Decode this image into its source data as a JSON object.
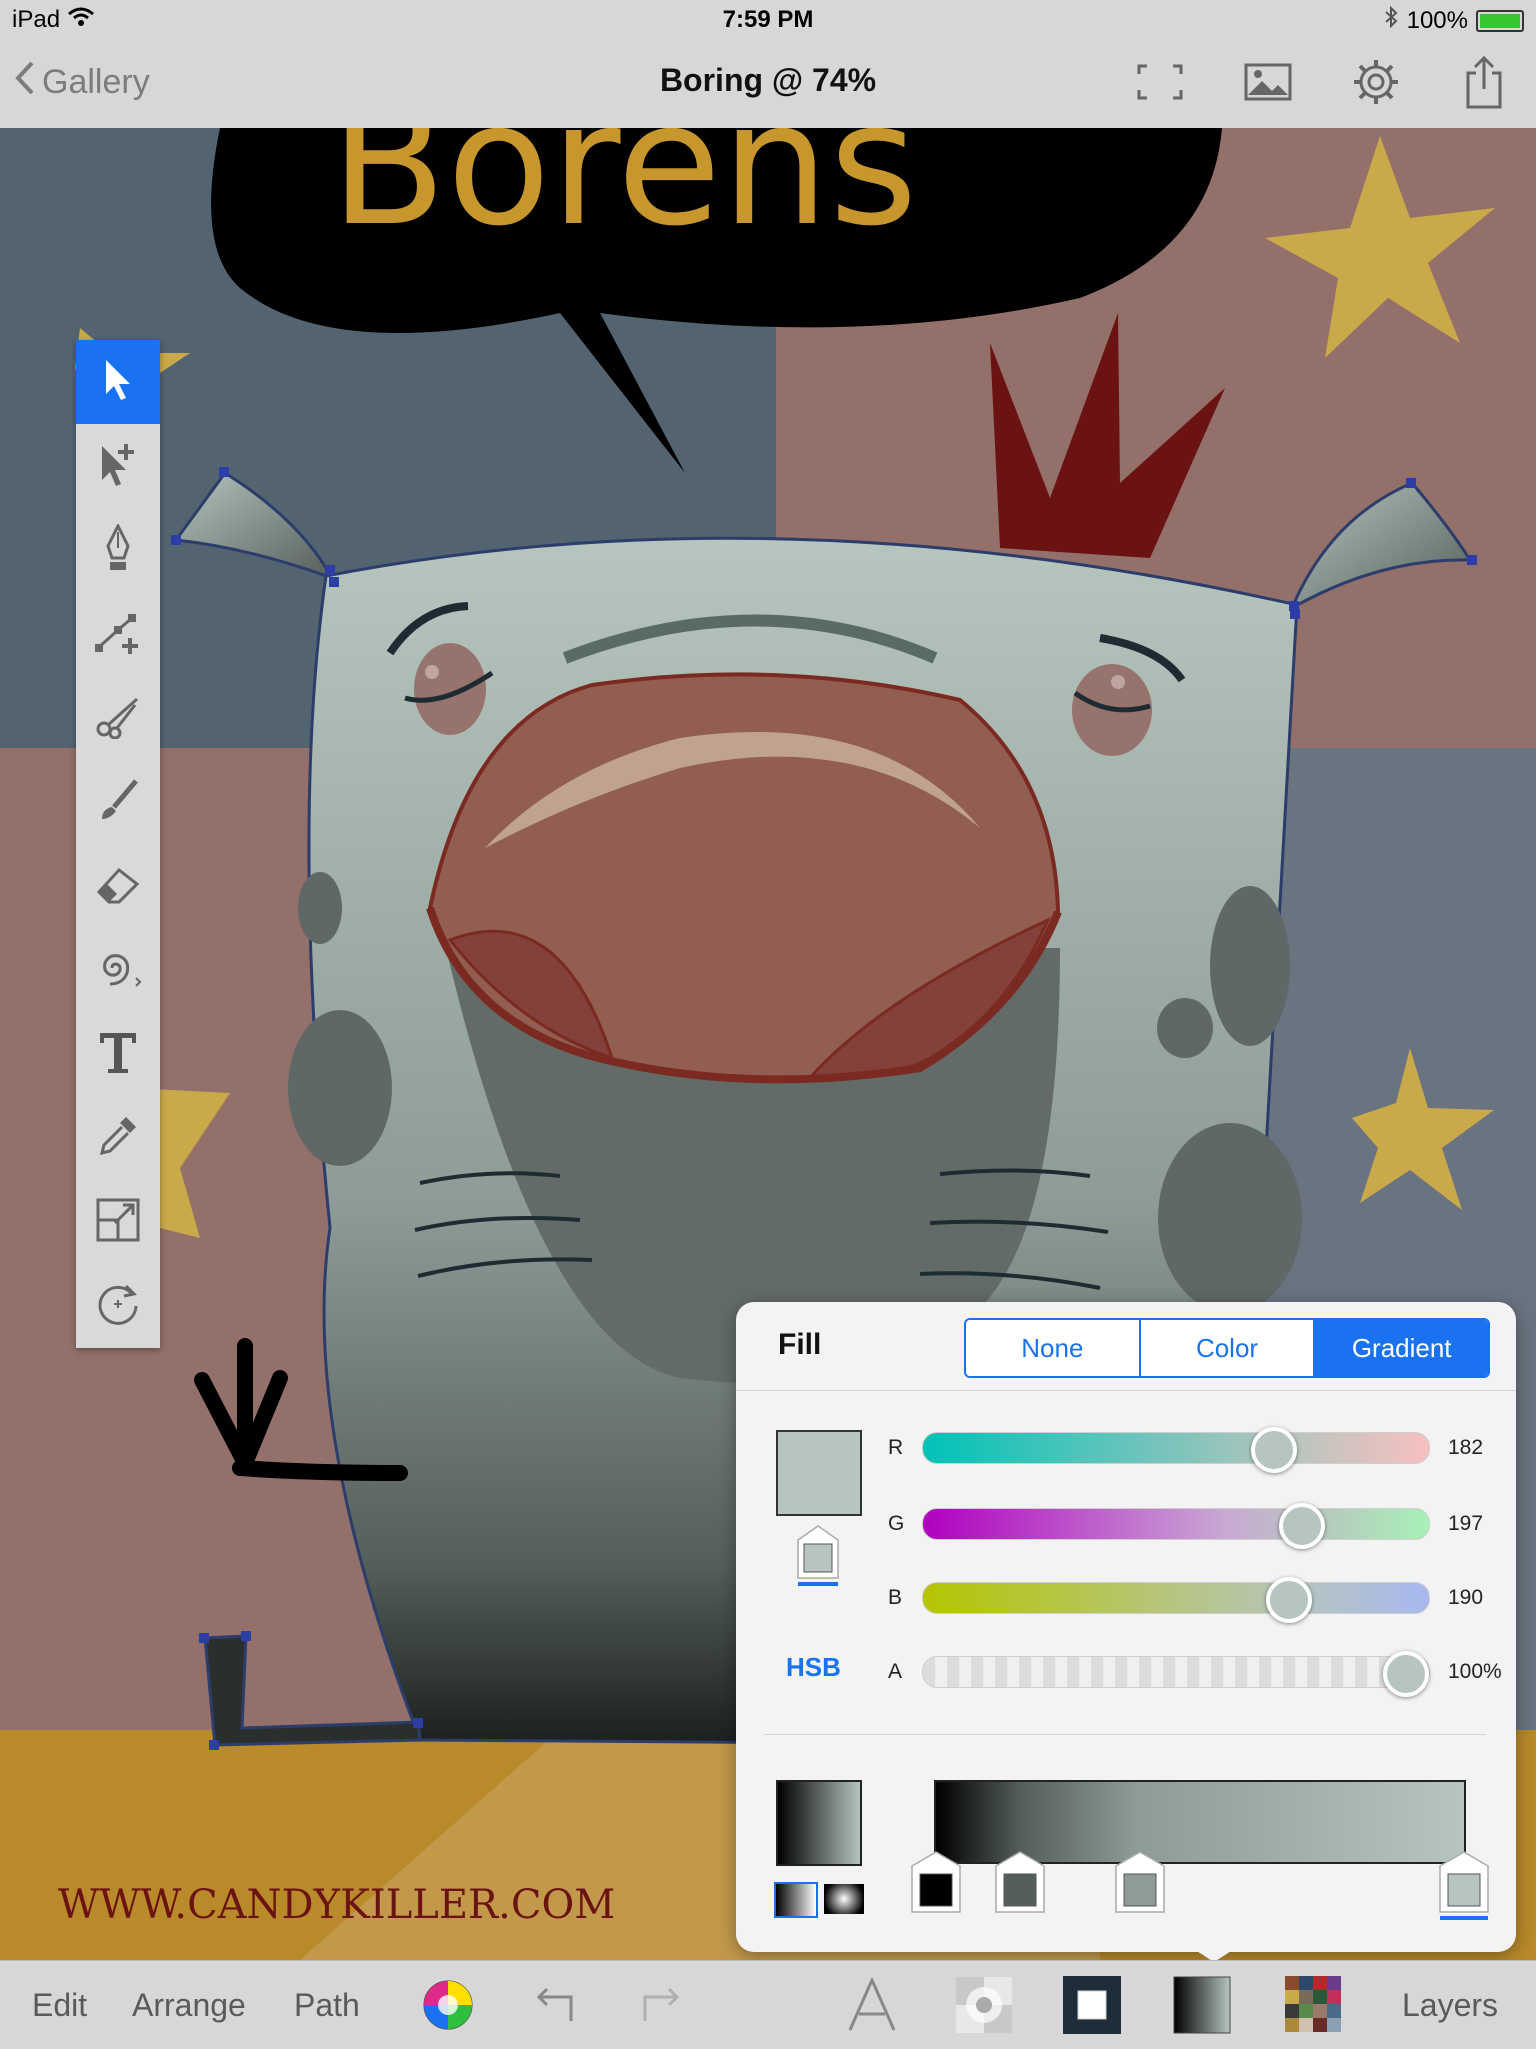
{
  "status": {
    "device": "iPad",
    "time": "7:59 PM",
    "battery": "100%"
  },
  "nav": {
    "back_label": "Gallery",
    "title": "Boring @ 74%"
  },
  "artwork": {
    "speech_text": "Borens",
    "website": "WWW.CANDYKILLER.COM"
  },
  "tools": [
    "select-icon",
    "direct-select-icon",
    "pen-icon",
    "node-add-icon",
    "scissors-icon",
    "brush-icon",
    "eraser-icon",
    "spiral-icon",
    "text-icon",
    "eyedropper-icon",
    "scale-icon",
    "rotate-icon"
  ],
  "fill_panel": {
    "title": "Fill",
    "modes": [
      "None",
      "Color",
      "Gradient"
    ],
    "active_mode": "Gradient",
    "hsb_label": "HSB",
    "swatch_color": "#b6c5be",
    "sliders": [
      {
        "label": "R",
        "value": "182",
        "fraction": 0.714
      },
      {
        "label": "G",
        "value": "197",
        "fraction": 0.773
      },
      {
        "label": "B",
        "value": "190",
        "fraction": 0.745
      },
      {
        "label": "A",
        "value": "100%",
        "fraction": 1.0
      }
    ],
    "gradient_stops": [
      "#000000",
      "#545e5b",
      "#8e9b97",
      "#b6c5be"
    ]
  },
  "bottom": {
    "edit": "Edit",
    "arrange": "Arrange",
    "path": "Path",
    "layers": "Layers"
  }
}
